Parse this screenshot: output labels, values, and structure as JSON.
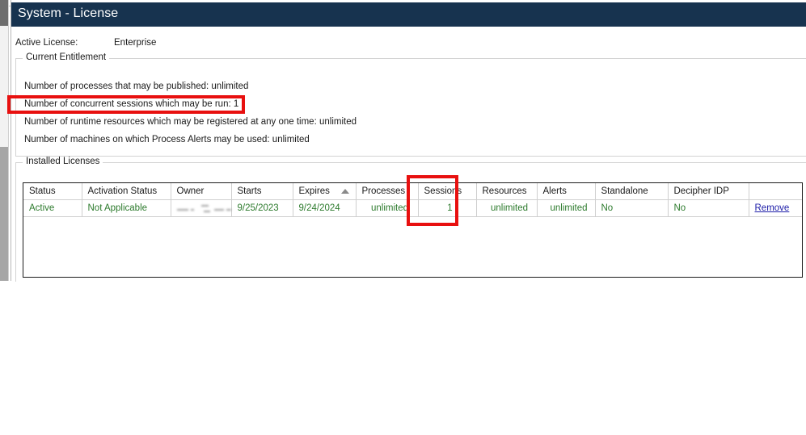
{
  "window": {
    "title": "System - License"
  },
  "top_tabs": [
    {
      "label": "",
      "selected": false
    },
    {
      "label": "",
      "selected": false
    },
    {
      "label": "",
      "selected": false
    },
    {
      "label": "",
      "selected": false
    },
    {
      "label": "",
      "selected": true
    },
    {
      "label": "",
      "selected": false
    }
  ],
  "active_license": {
    "label": "Active License:",
    "value": "Enterprise"
  },
  "entitlement": {
    "legend": "Current Entitlement",
    "lines": [
      "Number of processes that may be published: unlimited",
      "Number of concurrent sessions which may be run: 1",
      "Number of runtime resources which may be registered at any one time: unlimited",
      "Number of machines on which Process Alerts may be used: unlimited"
    ]
  },
  "installed_licenses": {
    "legend": "Installed Licenses",
    "columns": [
      "Status",
      "Activation Status",
      "Owner",
      "Starts",
      "Expires",
      "Processes",
      "Sessions",
      "Resources",
      "Alerts",
      "Standalone",
      "Decipher IDP",
      ""
    ],
    "sorted_column": "Expires",
    "sort_direction": "ascending",
    "rows": [
      {
        "status": "Active",
        "activation_status": "Not Applicable",
        "owner": "",
        "starts": "9/25/2023",
        "expires": "9/24/2024",
        "processes": "unlimited",
        "sessions": "1",
        "resources": "unlimited",
        "alerts": "unlimited",
        "standalone": "No",
        "decipher_idp": "No",
        "action": "Remove"
      }
    ]
  },
  "annotations": [
    {
      "name": "concurrent-sessions-highlight",
      "target": "Number of concurrent sessions which may be run: 1",
      "color": "#e8100f"
    },
    {
      "name": "sessions-column-highlight",
      "target": "Sessions",
      "color": "#e8100f"
    }
  ],
  "colors": {
    "title_bar": "#17334f",
    "value_green": "#2c7a2c",
    "link_blue": "#1c1ca8",
    "annotation_red": "#e8100f"
  }
}
